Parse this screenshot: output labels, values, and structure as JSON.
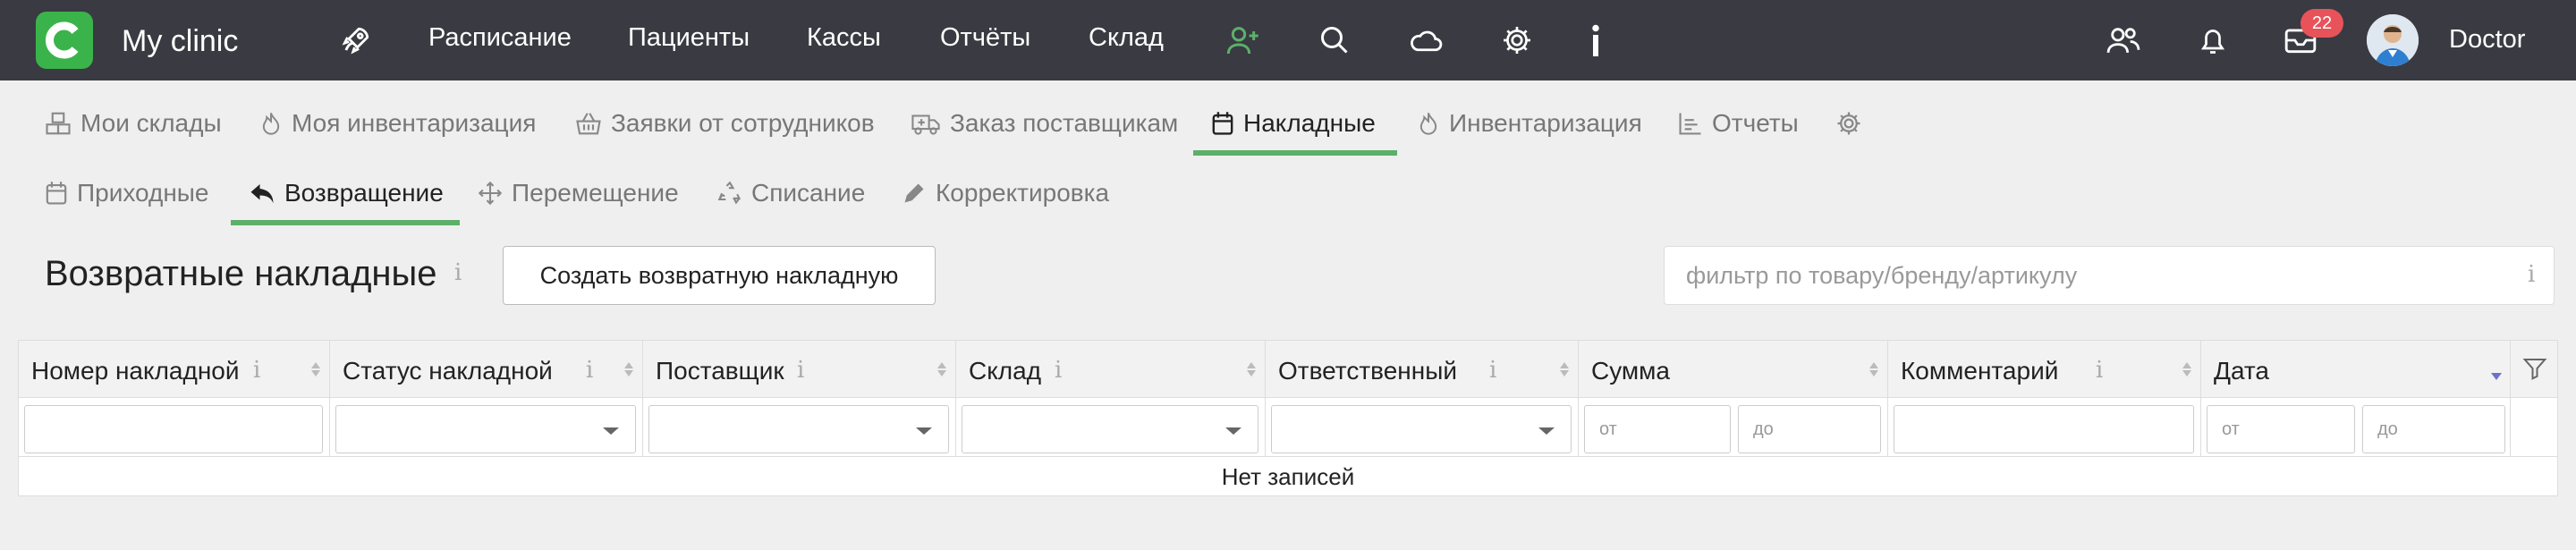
{
  "app": {
    "title": "My clinic",
    "brand_color": "#3ab44a"
  },
  "topnav": {
    "links": [
      "Расписание",
      "Пациенты",
      "Кассы",
      "Отчёты",
      "Склад"
    ],
    "icons": [
      "rocket-icon",
      "add-user-icon",
      "search-icon",
      "cloud-icon",
      "gear-icon",
      "info-icon",
      "users-icon",
      "bell-icon",
      "mail-icon"
    ],
    "mail_badge": "22",
    "user_name": "Doctor"
  },
  "tabs_main": [
    {
      "label": "Мои склады",
      "icon": "boxes-icon"
    },
    {
      "label": "Моя инвентаризация",
      "icon": "flame-icon"
    },
    {
      "label": "Заявки от сотрудников",
      "icon": "basket-icon"
    },
    {
      "label": "Заказ поставщикам",
      "icon": "truck-icon"
    },
    {
      "label": "Накладные",
      "icon": "calendar-icon",
      "active": true
    },
    {
      "label": "Инвентаризация",
      "icon": "flame-icon"
    },
    {
      "label": "Отчеты",
      "icon": "chart-icon"
    }
  ],
  "tabs_sub": [
    {
      "label": "Приходные",
      "icon": "calendar-icon"
    },
    {
      "label": "Возвращение",
      "icon": "reply-icon",
      "active": true
    },
    {
      "label": "Перемещение",
      "icon": "move-icon"
    },
    {
      "label": "Списание",
      "icon": "recycle-icon"
    },
    {
      "label": "Корректировка",
      "icon": "pencil-icon"
    }
  ],
  "page": {
    "title": "Возвратные накладные",
    "info": "i",
    "create_button": "Создать возвратную накладную",
    "filter_placeholder": "фильтр по товару/бренду/артикулу",
    "filter_info": "i"
  },
  "table": {
    "columns": [
      "Номер накладной",
      "Статус накладной",
      "Поставщик",
      "Склад",
      "Ответственный",
      "Сумма",
      "Комментарий",
      "Дата"
    ],
    "range_from": "от",
    "range_to": "до",
    "empty_text": "Нет записей"
  },
  "accent_color": "#5cb06a"
}
